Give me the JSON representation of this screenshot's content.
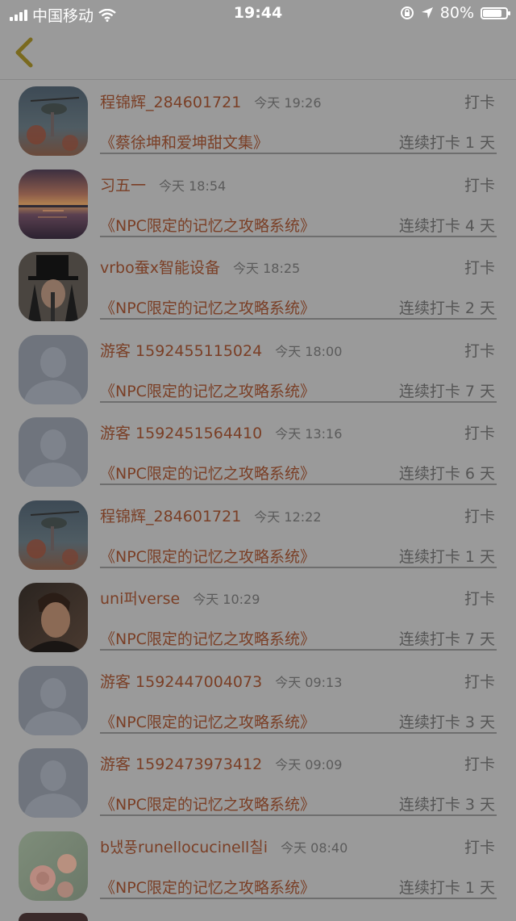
{
  "status_bar": {
    "carrier": "中国移动",
    "time": "19:44",
    "battery_percent": "80%"
  },
  "feed": [
    {
      "user": "程锦辉_284601721",
      "time": "今天 19:26",
      "action": "打卡",
      "book": "《蔡徐坤和爱坤甜文集》",
      "streak": "连续打卡 1 天",
      "avatar": "helicopter"
    },
    {
      "user": "习五一",
      "time": "今天 18:54",
      "action": "打卡",
      "book": "《NPC限定的记忆之攻略系统》",
      "streak": "连续打卡 4 天",
      "avatar": "sunset"
    },
    {
      "user": "vrbo蚕x智能设备",
      "time": "今天 18:25",
      "action": "打卡",
      "book": "《NPC限定的记忆之攻略系统》",
      "streak": "连续打卡 2 天",
      "avatar": "tophat"
    },
    {
      "user": "游客 1592455115024",
      "time": "今天 18:00",
      "action": "打卡",
      "book": "《NPC限定的记忆之攻略系统》",
      "streak": "连续打卡 7 天",
      "avatar": "default"
    },
    {
      "user": "游客 1592451564410",
      "time": "今天 13:16",
      "action": "打卡",
      "book": "《NPC限定的记忆之攻略系统》",
      "streak": "连续打卡 6 天",
      "avatar": "default"
    },
    {
      "user": "程锦辉_284601721",
      "time": "今天 12:22",
      "action": "打卡",
      "book": "《NPC限定的记忆之攻略系统》",
      "streak": "连续打卡 1 天",
      "avatar": "helicopter"
    },
    {
      "user": "uni퍼verse",
      "time": "今天 10:29",
      "action": "打卡",
      "book": "《NPC限定的记忆之攻略系统》",
      "streak": "连续打卡 7 天",
      "avatar": "portrait"
    },
    {
      "user": "游客 1592447004073",
      "time": "今天 09:13",
      "action": "打卡",
      "book": "《NPC限定的记忆之攻略系统》",
      "streak": "连续打卡 3 天",
      "avatar": "default"
    },
    {
      "user": "游客 1592473973412",
      "time": "今天 09:09",
      "action": "打卡",
      "book": "《NPC限定的记忆之攻略系统》",
      "streak": "连续打卡 3 天",
      "avatar": "default"
    },
    {
      "user": "b냈풍runellocucinell칠i",
      "time": "今天 08:40",
      "action": "打卡",
      "book": "《NPC限定的记忆之攻略系统》",
      "streak": "连续打卡 1 天",
      "avatar": "roses"
    }
  ]
}
